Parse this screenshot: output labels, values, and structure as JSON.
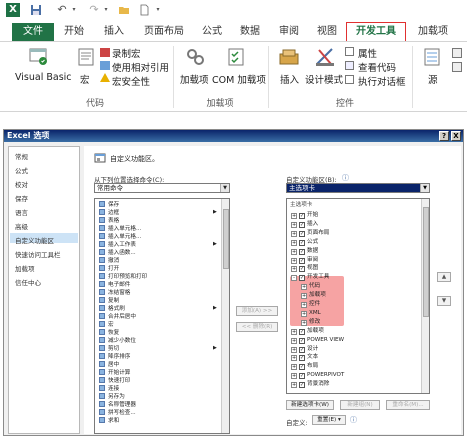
{
  "excel": {
    "logo": "X",
    "tabs": {
      "file": "文件",
      "home": "开始",
      "insert": "插入",
      "layout": "页面布局",
      "formulas": "公式",
      "data": "数据",
      "review": "审阅",
      "view": "视图",
      "developer": "开发工具",
      "addins": "加载项"
    },
    "ribbon": {
      "code": {
        "visual_basic": "Visual Basic",
        "macros": "宏",
        "record_macro": "录制宏",
        "relative_ref": "使用相对引用",
        "macro_security": "宏安全性",
        "group_label": "代码"
      },
      "addins": {
        "addins": "加载项",
        "com_addins": "COM 加载项",
        "group_label": "加载项"
      },
      "controls": {
        "insert": "插入",
        "design_mode": "设计模式",
        "properties": "属性",
        "view_code": "查看代码",
        "run_dialog": "执行对话框",
        "group_label": "控件"
      },
      "xml": {
        "source": "源"
      }
    }
  },
  "dialog": {
    "title": "Excel 选项",
    "help_btn": "?",
    "close_btn": "X",
    "nav": [
      "常规",
      "公式",
      "校对",
      "保存",
      "语言",
      "高级",
      "自定义功能区",
      "快速访问工具栏",
      "加载项",
      "信任中心"
    ],
    "nav_selected_index": 6,
    "heading": "自定义功能区。",
    "left_label": "从下列位置选择命令(C):",
    "left_combo": "常用命令",
    "right_label": "自定义功能区(B):",
    "right_combo": "主选项卡",
    "commands": [
      "保存",
      "边框",
      "表格",
      "插入单元格...",
      "插入单元格...",
      "插入工作表",
      "插入函数...",
      "撤消",
      "打开",
      "打印预览和打印",
      "电子邮件",
      "冻结窗格",
      "复制",
      "格式刷",
      "合并后居中",
      "宏",
      "恢复",
      "减少小数位",
      "剪切",
      "降序排序",
      "居中",
      "开始计算",
      "快速打印",
      "连接",
      "另存为",
      "名称管理器",
      "拼写检查...",
      "求和"
    ],
    "add_btn": "添加(A) >>",
    "remove_btn": "<< 删除(R)",
    "tree_header": "主选项卡",
    "tree": [
      {
        "label": "开始",
        "level": 0,
        "sign": "+"
      },
      {
        "label": "插入",
        "level": 0,
        "sign": "+"
      },
      {
        "label": "页面布局",
        "level": 0,
        "sign": "+"
      },
      {
        "label": "公式",
        "level": 0,
        "sign": "+"
      },
      {
        "label": "数据",
        "level": 0,
        "sign": "+"
      },
      {
        "label": "审阅",
        "level": 0,
        "sign": "+"
      },
      {
        "label": "视图",
        "level": 0,
        "sign": "+"
      },
      {
        "label": "开发工具",
        "level": 0,
        "sign": "-",
        "hl": true
      },
      {
        "label": "代码",
        "level": 1,
        "sign": "+",
        "hl": true
      },
      {
        "label": "加载项",
        "level": 1,
        "sign": "+",
        "hl": true
      },
      {
        "label": "控件",
        "level": 1,
        "sign": "+",
        "hl": true
      },
      {
        "label": "XML",
        "level": 1,
        "sign": "+",
        "hl": true
      },
      {
        "label": "修改",
        "level": 1,
        "sign": "+",
        "hl": true
      },
      {
        "label": "加载项",
        "level": 0,
        "sign": "+"
      },
      {
        "label": "POWER VIEW",
        "level": 0,
        "sign": "+"
      },
      {
        "label": "设计",
        "level": 0,
        "sign": "+"
      },
      {
        "label": "文本",
        "level": 0,
        "sign": "+"
      },
      {
        "label": "布局",
        "level": 0,
        "sign": "+"
      },
      {
        "label": "POWERPIVOT",
        "level": 0,
        "sign": "+"
      },
      {
        "label": "背景消除",
        "level": 0,
        "sign": "+"
      }
    ],
    "up_btn": "▲",
    "down_btn": "▼",
    "new_tab": "新建选项卡(W)",
    "new_group": "新建组(N)",
    "rename": "重命名(M)...",
    "customize_label": "自定义:",
    "reset": "重置(E) ▾",
    "info": "ⓘ"
  },
  "colors": {
    "excel_green": "#217346",
    "highlight": "#f6a3a3",
    "selected_nav": "#cde3f6",
    "dev_tab_border": "#e03030"
  }
}
